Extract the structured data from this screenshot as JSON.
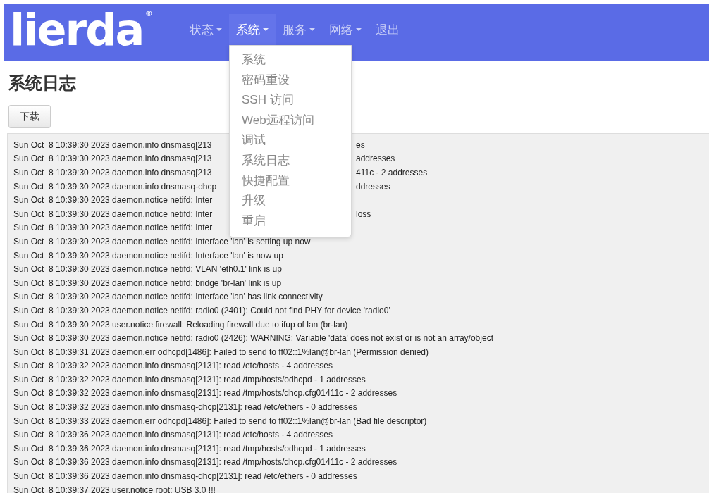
{
  "header": {
    "logo": "lierda",
    "logo_mark": "®",
    "nav": [
      {
        "label": "状态",
        "caret": true,
        "selected": false
      },
      {
        "label": "系统",
        "caret": true,
        "selected": true,
        "menu": [
          "系统",
          "密码重设",
          "SSH 访问",
          "Web远程访问",
          "调试",
          "系统日志",
          "快捷配置",
          "升级",
          "重启"
        ]
      },
      {
        "label": "服务",
        "caret": true,
        "selected": false
      },
      {
        "label": "网络",
        "caret": true,
        "selected": false
      },
      {
        "label": "退出",
        "caret": false,
        "selected": false
      }
    ]
  },
  "page_title": "系统日志",
  "download_button": "下载",
  "log": [
    {
      "text": "Sun Oct  8 10:39:30 2023 daemon.info dnsmasq[213",
      "after": "es"
    },
    {
      "text": "Sun Oct  8 10:39:30 2023 daemon.info dnsmasq[213",
      "after": "addresses"
    },
    {
      "text": "Sun Oct  8 10:39:30 2023 daemon.info dnsmasq[213",
      "after": "411c - 2 addresses"
    },
    {
      "text": "Sun Oct  8 10:39:30 2023 daemon.info dnsmasq-dhcp",
      "after": "ddresses"
    },
    {
      "text": "Sun Oct  8 10:39:30 2023 daemon.notice netifd: Inter"
    },
    {
      "text": "Sun Oct  8 10:39:30 2023 daemon.notice netifd: Inter",
      "after": "loss"
    },
    {
      "text": "Sun Oct  8 10:39:30 2023 daemon.notice netifd: Inter"
    },
    {
      "text": "Sun Oct  8 10:39:30 2023 daemon.notice netifd: Interface 'lan' is setting up now"
    },
    {
      "text": "Sun Oct  8 10:39:30 2023 daemon.notice netifd: Interface 'lan' is now up"
    },
    {
      "text": "Sun Oct  8 10:39:30 2023 daemon.notice netifd: VLAN 'eth0.1' link is up"
    },
    {
      "text": "Sun Oct  8 10:39:30 2023 daemon.notice netifd: bridge 'br-lan' link is up"
    },
    {
      "text": "Sun Oct  8 10:39:30 2023 daemon.notice netifd: Interface 'lan' has link connectivity"
    },
    {
      "text": "Sun Oct  8 10:39:30 2023 daemon.notice netifd: radio0 (2401): Could not find PHY for device 'radio0'"
    },
    {
      "text": "Sun Oct  8 10:39:30 2023 user.notice firewall: Reloading firewall due to ifup of lan (br-lan)"
    },
    {
      "text": "Sun Oct  8 10:39:30 2023 daemon.notice netifd: radio0 (2426): WARNING: Variable 'data' does not exist or is not an array/object"
    },
    {
      "text": "Sun Oct  8 10:39:31 2023 daemon.err odhcpd[1486]: Failed to send to ff02::1%lan@br-lan (Permission denied)"
    },
    {
      "text": "Sun Oct  8 10:39:32 2023 daemon.info dnsmasq[2131]: read /etc/hosts - 4 addresses"
    },
    {
      "text": "Sun Oct  8 10:39:32 2023 daemon.info dnsmasq[2131]: read /tmp/hosts/odhcpd - 1 addresses"
    },
    {
      "text": "Sun Oct  8 10:39:32 2023 daemon.info dnsmasq[2131]: read /tmp/hosts/dhcp.cfg01411c - 2 addresses"
    },
    {
      "text": "Sun Oct  8 10:39:32 2023 daemon.info dnsmasq-dhcp[2131]: read /etc/ethers - 0 addresses"
    },
    {
      "text": "Sun Oct  8 10:39:33 2023 daemon.err odhcpd[1486]: Failed to send to ff02::1%lan@br-lan (Bad file descriptor)"
    },
    {
      "text": "Sun Oct  8 10:39:36 2023 daemon.info dnsmasq[2131]: read /etc/hosts - 4 addresses"
    },
    {
      "text": "Sun Oct  8 10:39:36 2023 daemon.info dnsmasq[2131]: read /tmp/hosts/odhcpd - 1 addresses"
    },
    {
      "text": "Sun Oct  8 10:39:36 2023 daemon.info dnsmasq[2131]: read /tmp/hosts/dhcp.cfg01411c - 2 addresses"
    },
    {
      "text": "Sun Oct  8 10:39:36 2023 daemon.info dnsmasq-dhcp[2131]: read /etc/ethers - 0 addresses"
    },
    {
      "text": "Sun Oct  8 10:39:37 2023 user.notice root: USB 3.0 !!!"
    }
  ]
}
